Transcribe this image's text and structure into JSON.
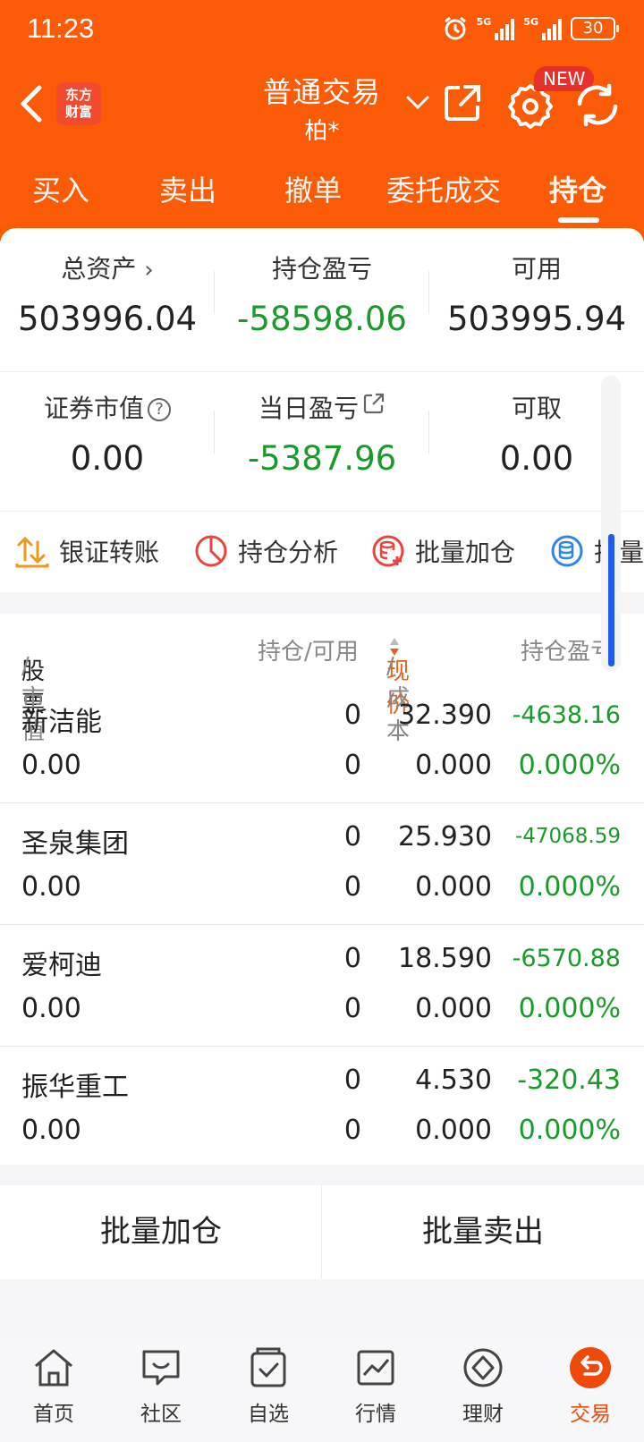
{
  "status_bar": {
    "time": "11:23",
    "battery": "30",
    "net1": "5G",
    "net2": "5G"
  },
  "header": {
    "title": "普通交易",
    "subtitle": "柏*",
    "logo_line1": "东方",
    "logo_line2": "财富",
    "new_badge": "NEW"
  },
  "tabs": [
    {
      "label": "买入"
    },
    {
      "label": "卖出"
    },
    {
      "label": "撤单"
    },
    {
      "label": "委托成交"
    },
    {
      "label": "持仓",
      "active": true
    }
  ],
  "summary": {
    "total_assets_label": "总资产",
    "total_assets": "503996.04",
    "position_pnl_label": "持仓盈亏",
    "position_pnl": "-58598.06",
    "available_label": "可用",
    "available": "503995.94",
    "market_value_label": "证券市值",
    "market_value": "0.00",
    "daily_pnl_label": "当日盈亏",
    "daily_pnl": "-5387.96",
    "withdrawable_label": "可取",
    "withdrawable": "0.00"
  },
  "actions": [
    {
      "label": "银证转账"
    },
    {
      "label": "持仓分析"
    },
    {
      "label": "批量加仓"
    },
    {
      "label": "批量"
    }
  ],
  "table": {
    "col_stock": "股票",
    "col_mv": "/市值",
    "col_position": "持仓/可用",
    "col_price_active": "现价",
    "col_price_rest": "/成本",
    "col_pnl": "持仓盈亏",
    "rows": [
      {
        "name": "新洁能",
        "market_value": "0.00",
        "position": "0",
        "available": "0",
        "price": "32.390",
        "cost": "0.000",
        "pnl": "-4638.16",
        "pnl_pct": "0.000%"
      },
      {
        "name": "圣泉集团",
        "market_value": "0.00",
        "position": "0",
        "available": "0",
        "price": "25.930",
        "cost": "0.000",
        "pnl": "-47068.59",
        "pnl_pct": "0.000%"
      },
      {
        "name": "爱柯迪",
        "market_value": "0.00",
        "position": "0",
        "available": "0",
        "price": "18.590",
        "cost": "0.000",
        "pnl": "-6570.88",
        "pnl_pct": "0.000%"
      },
      {
        "name": "振华重工",
        "market_value": "0.00",
        "position": "0",
        "available": "0",
        "price": "4.530",
        "cost": "0.000",
        "pnl": "-320.43",
        "pnl_pct": "0.000%"
      }
    ]
  },
  "bottom_buttons": {
    "batch_add": "批量加仓",
    "batch_sell": "批量卖出"
  },
  "nav": [
    {
      "label": "首页",
      "icon": "home-icon"
    },
    {
      "label": "社区",
      "icon": "community-icon"
    },
    {
      "label": "自选",
      "icon": "watchlist-icon"
    },
    {
      "label": "行情",
      "icon": "market-icon"
    },
    {
      "label": "理财",
      "icon": "wealth-icon"
    },
    {
      "label": "交易",
      "icon": "trade-icon",
      "active": true
    }
  ],
  "colors": {
    "brand": "#fb5a06",
    "loss": "#1a9a2a",
    "accent_blue": "#1e5cf0",
    "nav_active": "#f04a0a"
  }
}
